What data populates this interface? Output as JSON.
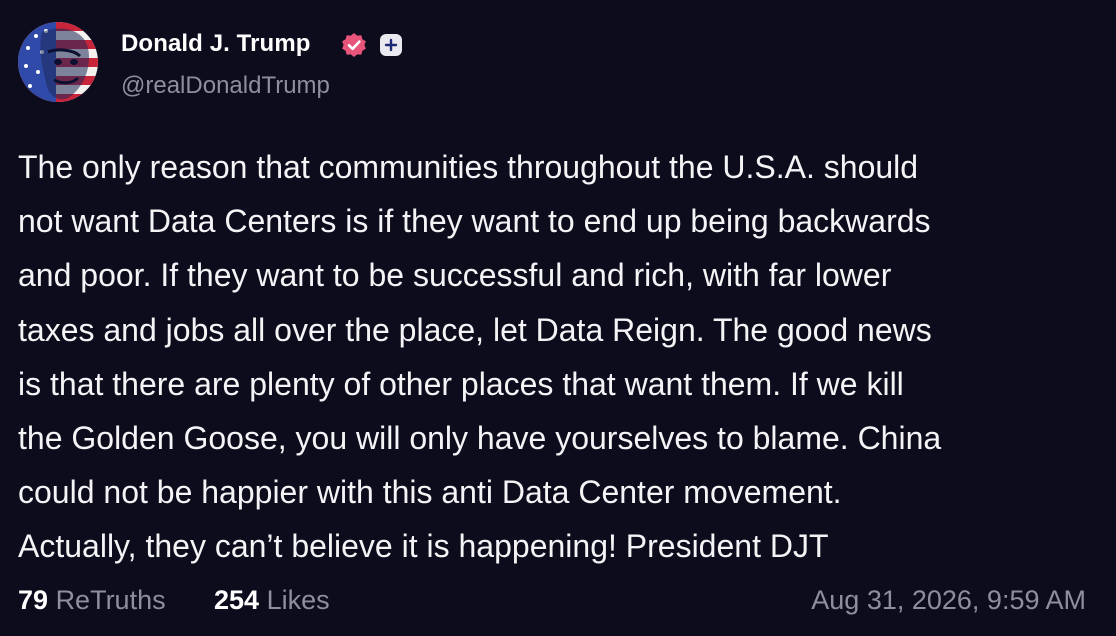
{
  "author": {
    "display_name": "Donald J. Trump",
    "handle": "@realDonaldTrump",
    "avatar_icon": "flag-portrait-avatar",
    "verified_icon": "verified-badge-icon",
    "plus_icon": "plus-badge-icon"
  },
  "post": {
    "lines": [
      "The only reason that communities throughout the U.S.A. should",
      "not want Data Centers is if they want to end up being backwards",
      "and poor. If they want to be successful and rich, with far lower",
      "taxes and jobs all over the place, let Data Reign. The good news",
      "is that there are plenty of other places that want them. If we kill",
      "the Golden Goose, you will only have yourselves to blame. China",
      "could not be happier with this anti Data Center movement.",
      "Actually, they can’t believe it is happening! President DJT"
    ]
  },
  "stats": {
    "retruths_count": "79",
    "retruths_label": "ReTruths",
    "likes_count": "254",
    "likes_label": "Likes"
  },
  "timestamp": "Aug 31, 2026, 9:59 AM",
  "colors": {
    "background": "#0d0c1d",
    "text": "#f4f4f6",
    "muted": "#8f8e9b",
    "verified": "#e8557a"
  }
}
